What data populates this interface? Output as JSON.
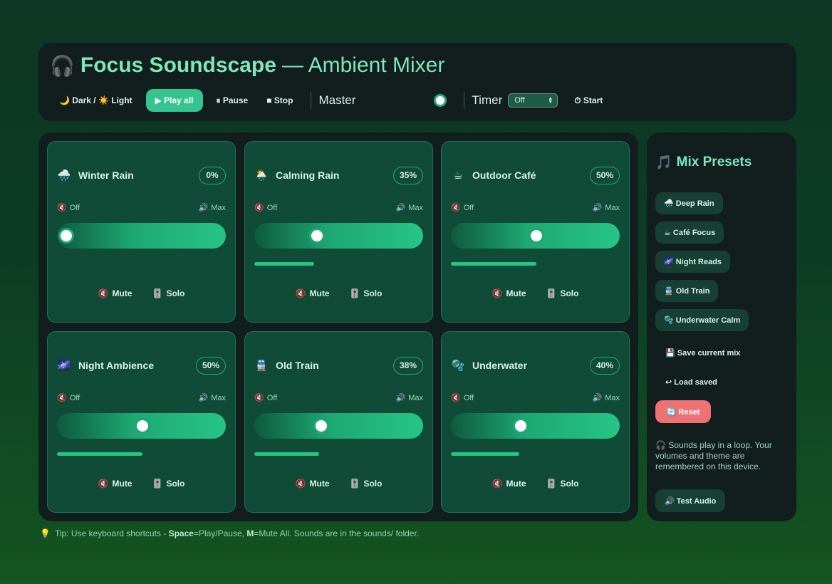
{
  "header": {
    "icon": "🎧",
    "title_bold": "Focus Soundscape",
    "title_rest": "— Ambient Mixer",
    "theme_toggle": "🌙 Dark / ☀️ Light",
    "play_all": "▶ Play all",
    "pause": "⏸ Pause",
    "stop": "■ Stop",
    "master_label": "Master",
    "master_level": 0.7,
    "timer_label": "Timer",
    "timer_value": "Off",
    "start": "⏱ Start"
  },
  "cards": [
    {
      "icon": "🌧️",
      "title": "Winter Rain",
      "pct": "0%",
      "level": 0.0,
      "off": "Off",
      "max": "Max",
      "mute": "Mute",
      "solo": "Solo"
    },
    {
      "icon": "🌦️",
      "title": "Calming Rain",
      "pct": "35%",
      "level": 0.35,
      "off": "Off",
      "max": "Max",
      "mute": "Mute",
      "solo": "Solo"
    },
    {
      "icon": "☕",
      "title": "Outdoor Café",
      "pct": "50%",
      "level": 0.5,
      "off": "Off",
      "max": "Max",
      "mute": "Mute",
      "solo": "Solo"
    },
    {
      "icon": "🌌",
      "title": "Night Ambience",
      "pct": "50%",
      "level": 0.5,
      "off": "Off",
      "max": "Max",
      "mute": "Mute",
      "solo": "Solo"
    },
    {
      "icon": "🚆",
      "title": "Old Train",
      "pct": "38%",
      "level": 0.38,
      "off": "Off",
      "max": "Max",
      "mute": "Mute",
      "solo": "Solo"
    },
    {
      "icon": "🫧",
      "title": "Underwater",
      "pct": "40%",
      "level": 0.4,
      "off": "Off",
      "max": "Max",
      "mute": "Mute",
      "solo": "Solo"
    }
  ],
  "side": {
    "title_icon": "🎵",
    "title": "Mix Presets",
    "presets": [
      "🌧️ Deep Rain",
      "☕ Café Focus",
      "🌌 Night Reads",
      "🚆 Old Train",
      "🫧 Underwater Calm"
    ],
    "save": "💾 Save current mix",
    "load": "↩ Load saved",
    "reset": "🔄 Reset",
    "info": "🎧 Sounds play in a loop. Your volumes and theme are remembered on this device.",
    "test_audio": "🔊 Test Audio"
  },
  "tip": {
    "icon": "💡",
    "prefix": "Tip: Use keyboard shortcuts - ",
    "k1": "Space",
    "t1": "=Play/Pause, ",
    "k2": "M",
    "t2": "=Mute All. Sounds are in the sounds/ folder."
  },
  "colors": {
    "accent": "#34c48f",
    "card_bg": "#0f4b37",
    "panel_bg": "#121d1e",
    "reset": "#f07174"
  }
}
